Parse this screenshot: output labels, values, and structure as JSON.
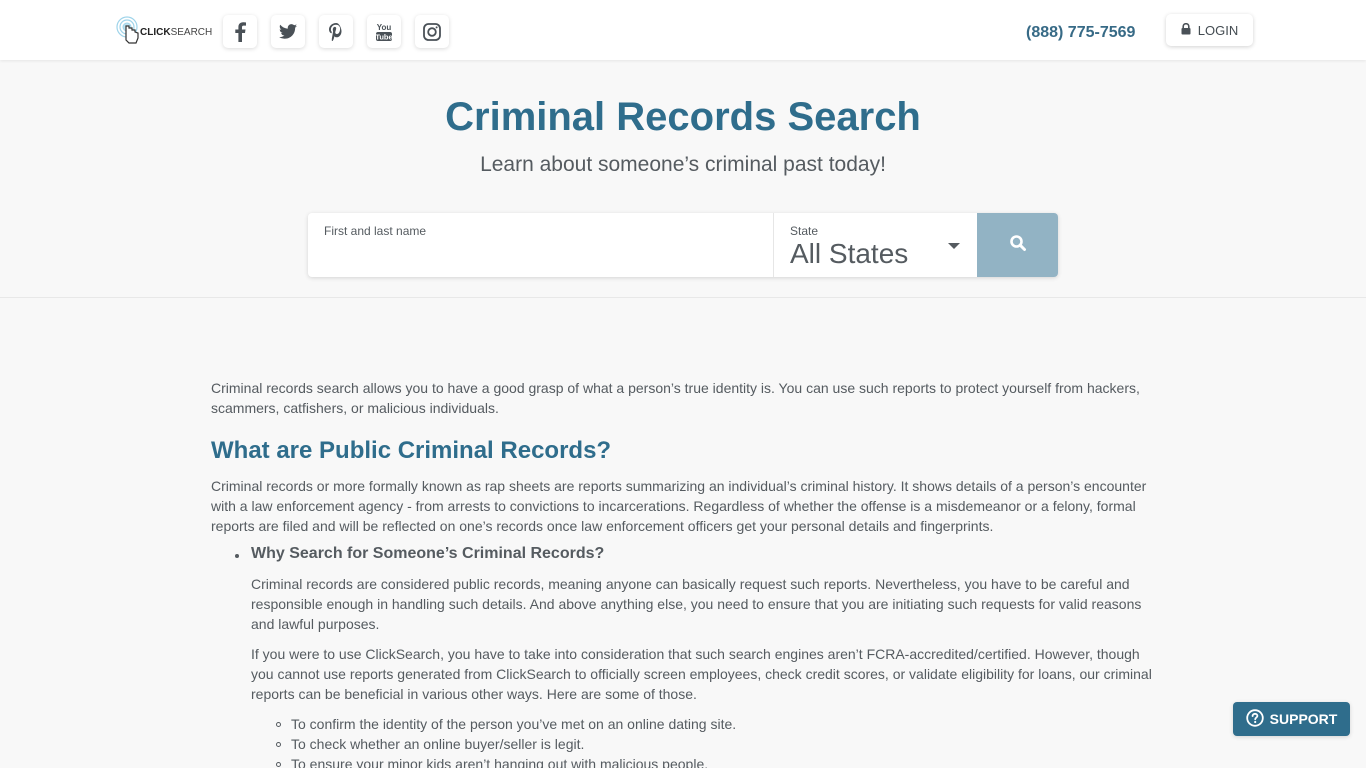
{
  "header": {
    "logo": {
      "bold": "CLICK",
      "light": "SEARCH"
    },
    "social": [
      {
        "name": "facebook",
        "icon": "facebook-icon"
      },
      {
        "name": "twitter",
        "icon": "twitter-icon"
      },
      {
        "name": "pinterest",
        "icon": "pinterest-icon"
      },
      {
        "name": "youtube",
        "icon": "youtube-icon"
      },
      {
        "name": "instagram",
        "icon": "instagram-icon"
      }
    ],
    "phone": "(888) 775-7569",
    "login_label": "LOGIN"
  },
  "hero": {
    "title": "Criminal Records Search",
    "subtitle": "Learn about someone’s criminal past today!",
    "search": {
      "name_label": "First and last name",
      "name_value": "",
      "name_placeholder": "",
      "state_label": "State",
      "state_value": "All States"
    }
  },
  "content": {
    "intro": "Criminal records search allows you to have a good grasp of what a person’s true identity is. You can use such reports to protect yourself from hackers, scammers, catfishers, or malicious individuals.",
    "heading": "What are Public Criminal Records?",
    "paragraph": "Criminal records or more formally known as rap sheets are reports summarizing an individual’s criminal history. It shows details of a person’s encounter with a law enforcement agency - from arrests to convictions to incarcerations. Regardless of whether the offense is a misdemeanor or a felony, formal reports are filed and will be reflected on one’s records once law enforcement officers get your personal details and fingerprints.",
    "bullet": {
      "title": "Why Search for Someone’s Criminal Records?",
      "p1": "Criminal records are considered public records, meaning anyone can basically request such reports. Nevertheless, you have to be careful and responsible enough in handling such details. And above anything else, you need to ensure that you are initiating such requests for valid reasons and lawful purposes.",
      "p2": "If you were to use ClickSearch, you have to take into consideration that such search engines aren’t FCRA-accredited/certified. However, though you cannot use reports generated from ClickSearch to officially screen employees, check credit scores, or validate eligibility for loans, our criminal reports can be beneficial in various other ways. Here are some of those.",
      "items": [
        "To confirm the identity of the person you’ve met on an online dating site.",
        "To check whether an online buyer/seller is legit.",
        "To ensure your minor kids aren’t hanging out with malicious people."
      ]
    }
  },
  "support_label": "SUPPORT",
  "colors": {
    "brand": "#2f6d8c",
    "search_button": "#92b3c4",
    "background": "#f8f8f8"
  }
}
